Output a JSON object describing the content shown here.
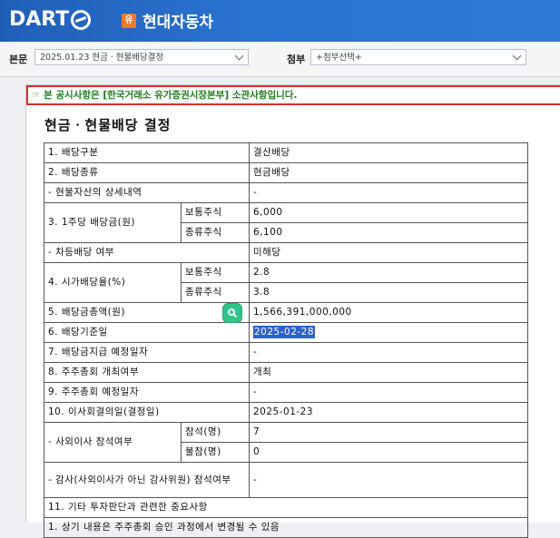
{
  "header": {
    "logo_text": "DART",
    "company_badge": "유",
    "company_name": "현대자동차"
  },
  "toolbar": {
    "main_label": "본문",
    "main_select_value": "2025.01.23  현금ㆍ현물배당결정",
    "attach_label": "첨부",
    "attach_select_value": "+첨부선택+"
  },
  "document": {
    "notice": "☞ 본 공시사항은 [한국거래소 유가증권시장본부] 소관사항입니다.",
    "title": "현금ㆍ현물배당 결정",
    "rows": {
      "r1_label": "1. 배당구분",
      "r1_value": "결산배당",
      "r2_label": "2. 배당종류",
      "r2_value": "현금배당",
      "r3_label": "- 현물자산의 상세내역",
      "r3_value": "-",
      "r4_label": "3. 1주당 배당금(원)",
      "r4a_sub": "보통주식",
      "r4a_value": "6,000",
      "r4b_sub": "종류주식",
      "r4b_value": "6,100",
      "r5_label": "- 차등배당 여부",
      "r5_value": "미해당",
      "r6_label": "4. 시가배당율(%)",
      "r6a_sub": "보통주식",
      "r6a_value": "2.8",
      "r6b_sub": "종류주식",
      "r6b_value": "3.8",
      "r7_label": "5. 배당금총액(원)",
      "r7_value": "1,566,391,000,000",
      "r8_label": "6. 배당기준일",
      "r8_value": "2025-02-28",
      "r9_label": "7. 배당금지급 예정일자",
      "r9_value": "-",
      "r10_label": "8. 주주총회 개최여부",
      "r10_value": "개최",
      "r11_label": "9. 주주총회 예정일자",
      "r11_value": "-",
      "r12_label": "10. 이사회결의일(결정일)",
      "r12_value": "2025-01-23",
      "r13_label": "- 사외이사 참석여부",
      "r13a_sub": "참석(명)",
      "r13a_value": "7",
      "r13b_sub": "불참(명)",
      "r13b_value": "0",
      "r14_label": "- 감사(사외이사가 아닌 감사위원) 참석여부",
      "r14_value": "-",
      "r15_label": "11. 기타 투자판단과 관련한 중요사항",
      "r16_label": "1. 상기 내용은 주주총회 승인 과정에서 변경될 수 있음"
    }
  }
}
